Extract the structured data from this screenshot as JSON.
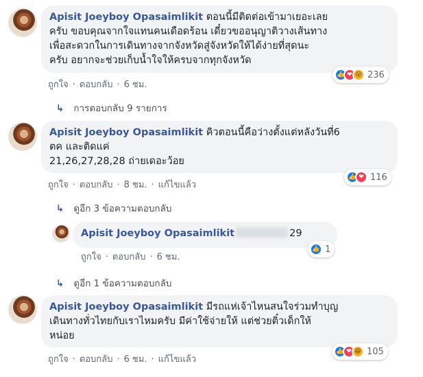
{
  "comments": [
    {
      "author": "Apisit Joeyboy Opasaimlikit",
      "text_lines": [
        "ตอนนี้มีติดต่อเข้ามาเยอะเลย",
        "ครับ ขอบคุณจากใจแทนคนเดือดร้อน เดี๋ยวขออนุญาติวางเส้นทาง",
        "เพื่อสะดวกในการเดินทางจากจังหวัดสู่จังหวัดให้ได้ง่ายที่สุดนะ",
        "ครับ อยากจะช่วยเก็บน้ำใจให้ครบจากทุกจังหวัด"
      ],
      "actions": {
        "like": "ถูกใจ",
        "reply": "ตอบกลับ",
        "time": "6 ชม."
      },
      "reactions": {
        "icons": [
          "like-icon",
          "love-icon",
          "wow-icon"
        ],
        "count": "236"
      },
      "replies_link": "การตอบกลับ 9 รายการ"
    },
    {
      "author": "Apisit Joeyboy Opasaimlikit",
      "text_lines": [
        "คิวตอนนี้คือว่างตั้งแต่หลังวันที่6",
        "ตค และติดแค่",
        "21,26,27,28,28 ถ่ายเดอะว้อย"
      ],
      "actions": {
        "like": "ถูกใจ",
        "reply": "ตอบกลับ",
        "time": "8 ชม.",
        "edited": "แก้ไขแล้ว"
      },
      "reactions": {
        "icons": [
          "like-icon",
          "love-icon"
        ],
        "count": "116"
      },
      "replies_link": "ดูอีก 3 ข้อความตอบกลับ"
    },
    {
      "author": "Apisit Joeyboy Opasaimlikit",
      "text": "29",
      "actions": {
        "like": "ถูกใจ",
        "reply": "ตอบกลับ",
        "time": "6 ชม."
      },
      "reactions": {
        "icons": [
          "like-icon"
        ],
        "count": "1"
      },
      "replies_link": "ดูอีก 1 ข้อความตอบกลับ"
    },
    {
      "author": "Apisit Joeyboy Opasaimlikit",
      "text_lines": [
        "มีรถแห่เจ้าไหนสนใจร่วมทำบุญ",
        "เดินทางทั่วไทยกับเราไหมครับ มีค่าใช้จ่ายให้ แต่ช่วยติ๋วเด็กให้",
        "หน่อย"
      ],
      "actions": {
        "like": "ถูกใจ",
        "reply": "ตอบกลับ",
        "time": "6 ชม.",
        "edited": "แก้ไขแล้ว"
      },
      "reactions": {
        "icons": [
          "like-icon",
          "love-icon",
          "haha-icon"
        ],
        "count": "105"
      }
    }
  ],
  "colors": {
    "author": "#385898",
    "bubble": "#f2f3f5",
    "like": "#1877f2",
    "love": "#f33e58",
    "wow": "#f7b125"
  }
}
